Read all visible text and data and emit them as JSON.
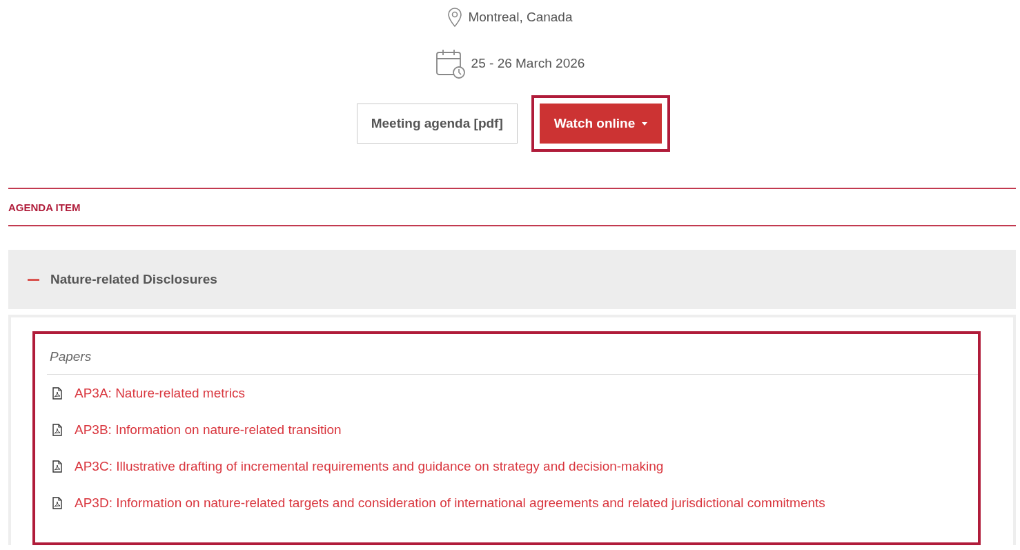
{
  "location": "Montreal, Canada",
  "date": "25 - 26 March 2026",
  "buttons": [
    {
      "label": "Meeting agenda [pdf]",
      "kind": "outline",
      "highlighted": false
    },
    {
      "label": "Watch online",
      "kind": "dropdown",
      "highlighted": true
    }
  ],
  "section_heading": "AGENDA ITEM",
  "agenda_items": [
    {
      "title": "Nature-related Disclosures",
      "expanded": true,
      "highlighted": true,
      "papers_heading": "Papers",
      "papers": [
        {
          "label": "AP3A: Nature-related metrics"
        },
        {
          "label": "AP3B: Information on nature-related transition"
        },
        {
          "label": "AP3C: Illustrative drafting of incremental requirements and guidance on strategy and decision-making"
        },
        {
          "label": "AP3D: Information on nature-related targets and consideration of international agreements and related jurisdictional commitments"
        }
      ]
    }
  ]
}
